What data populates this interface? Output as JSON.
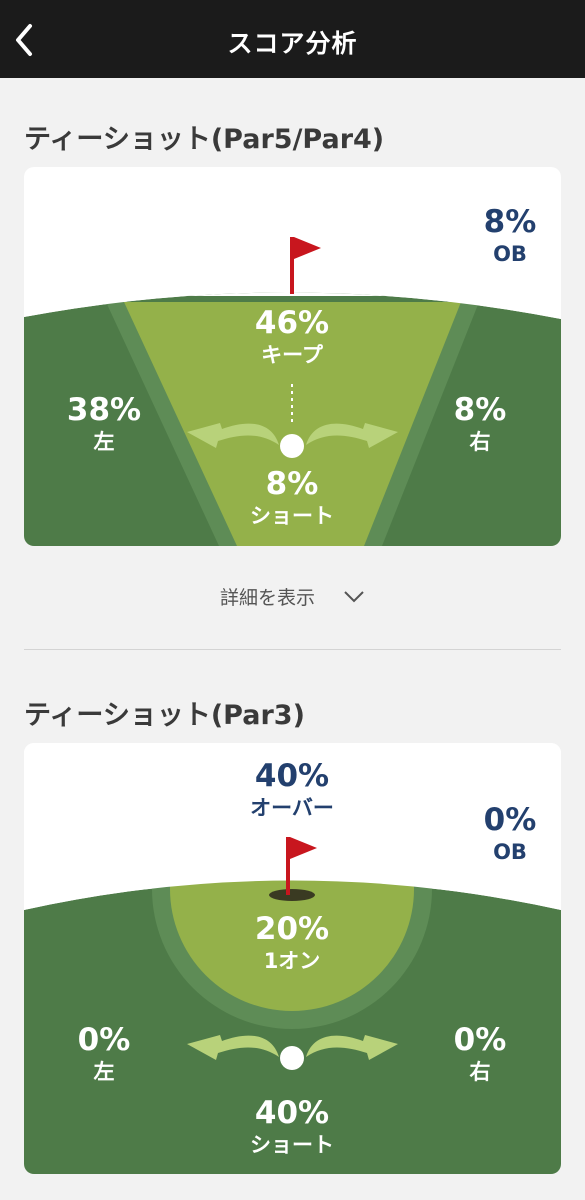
{
  "header": {
    "title": "スコア分析"
  },
  "section1": {
    "title": "ティーショット(Par5/Par4)",
    "ob": {
      "value": "8%",
      "label": "OB"
    },
    "keep": {
      "value": "46%",
      "label": "キープ"
    },
    "left": {
      "value": "38%",
      "label": "左"
    },
    "right": {
      "value": "8%",
      "label": "右"
    },
    "short": {
      "value": "8%",
      "label": "ショート"
    }
  },
  "details": {
    "label": "詳細を表示"
  },
  "section2": {
    "title": "ティーショット(Par3)",
    "over": {
      "value": "40%",
      "label": "オーバー"
    },
    "ob": {
      "value": "0%",
      "label": "OB"
    },
    "on": {
      "value": "20%",
      "label": "1オン"
    },
    "left": {
      "value": "0%",
      "label": "左"
    },
    "right": {
      "value": "0%",
      "label": "右"
    },
    "short": {
      "value": "40%",
      "label": "ショート"
    }
  },
  "colors": {
    "header_bg": "#1b1b1b",
    "fairway_dark": "#4e7b48",
    "fairway_mid": "#5e8c56",
    "fairway_light": "#94b14a",
    "arrow": "#b8d27a",
    "flag": "#c8161e",
    "accent_text": "#23406e"
  },
  "icons": [
    "back-chevron-icon",
    "flag-icon",
    "ball-icon",
    "arrow-left-icon",
    "arrow-right-icon",
    "chevron-down-icon"
  ]
}
